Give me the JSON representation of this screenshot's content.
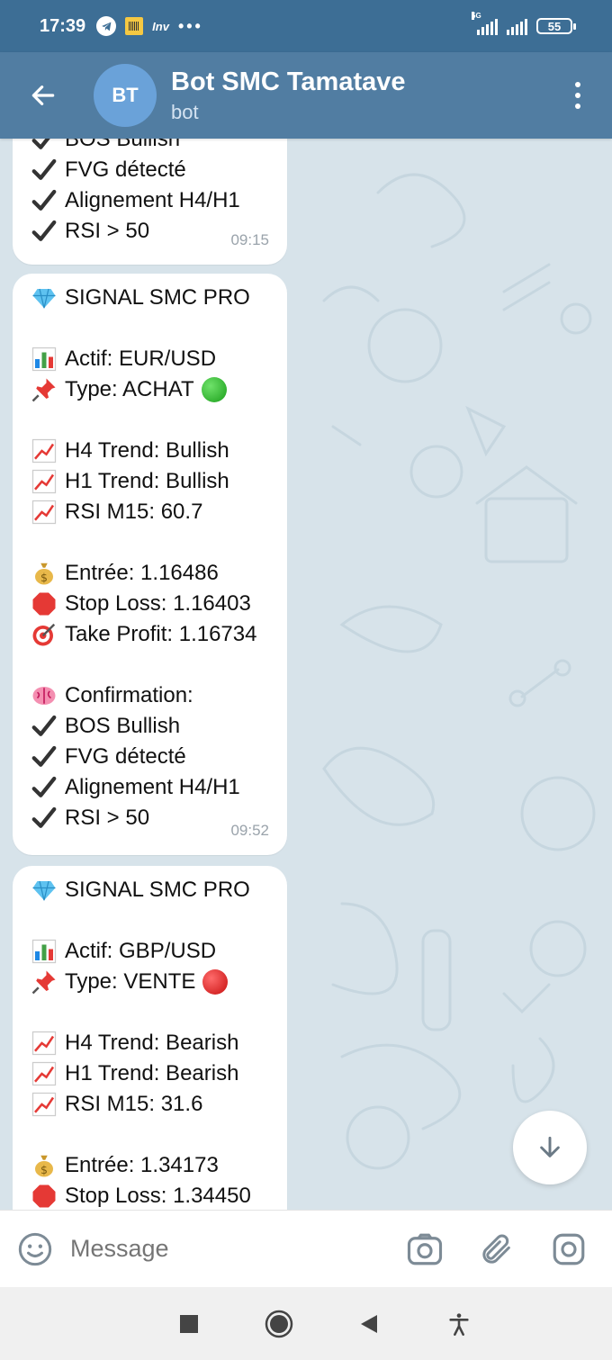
{
  "status_bar": {
    "time": "17:39",
    "inv_label": "Inv",
    "more_dots": "•••",
    "network": "5G",
    "battery": "55"
  },
  "header": {
    "avatar_initials": "BT",
    "title": "Bot SMC Tamatave",
    "subtitle": "bot"
  },
  "messages": [
    {
      "lines": [
        {
          "icon": "check-icon",
          "text": "BOS Bullish"
        },
        {
          "icon": "check-icon",
          "text": "FVG détecté"
        },
        {
          "icon": "check-icon",
          "text": "Alignement H4/H1"
        },
        {
          "icon": "check-icon",
          "text": "RSI > 50"
        }
      ],
      "time": "09:15"
    },
    {
      "title": "SIGNAL SMC PRO",
      "asset": "Actif: EUR/USD",
      "type": "Type: ACHAT",
      "h4": "H4 Trend: Bullish",
      "h1": "H1 Trend: Bullish",
      "rsi": "RSI M15: 60.7",
      "entry": "Entrée: 1.16486",
      "stop": "Stop Loss: 1.16403",
      "tp": "Take Profit: 1.16734",
      "confirm": "Confirmation:",
      "c1": "BOS Bullish",
      "c2": "FVG détecté",
      "c3": "Alignement H4/H1",
      "c4": "RSI > 50",
      "time": "09:52"
    },
    {
      "title": "SIGNAL SMC PRO",
      "asset": "Actif: GBP/USD",
      "type": "Type: VENTE",
      "h4": "H4 Trend: Bearish",
      "h1": "H1 Trend: Bearish",
      "rsi": "RSI M15: 31.6",
      "entry": "Entrée: 1.34173",
      "stop": "Stop Loss: 1.34450"
    }
  ],
  "input": {
    "placeholder": "Message"
  },
  "colors": {
    "header": "#517da2",
    "status_bar": "#3d6e95",
    "chat_bg": "#d7e3ea"
  }
}
